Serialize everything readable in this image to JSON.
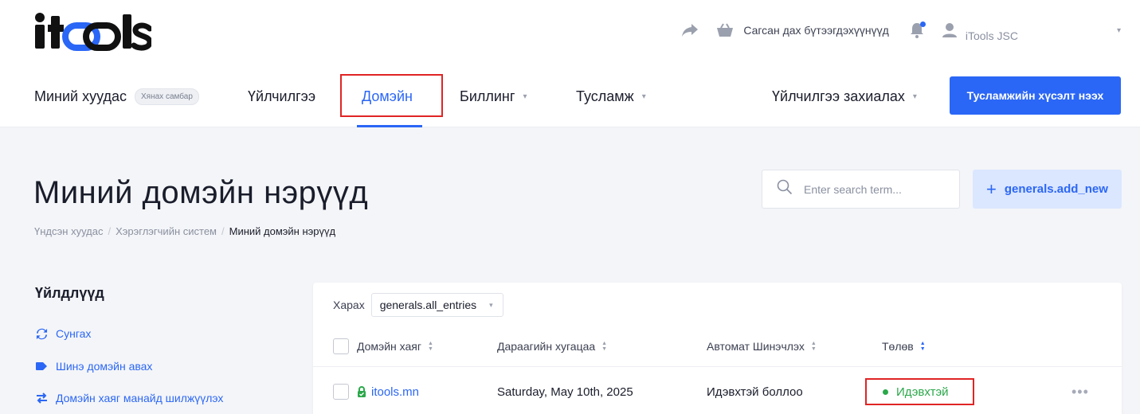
{
  "brand": {
    "logo_text": "itools",
    "accent": "#2b67f6",
    "status_green": "#2ba84a",
    "highlight_red": "#e02424"
  },
  "topbar": {
    "share_icon": "share-arrow-icon",
    "cart_icon": "basket-icon",
    "cart_label": "Сагсан дах бүтээгдэхүүнүүд",
    "bell_icon": "bell-icon",
    "user_icon": "user-icon",
    "user_label": "iTools JSC",
    "user_caret": "▾"
  },
  "nav": {
    "home_label": "Миний хуудас",
    "home_badge": "Хянах самбар",
    "services_label": "Үйлчилгээ",
    "domain_label": "Домэйн",
    "billing_label": "Биллинг",
    "help_label": "Тусламж",
    "order_label": "Үйлчилгээ захиалах",
    "caret": "▾",
    "support_button": "Тусламжийн хүсэлт нээх"
  },
  "page": {
    "title": "Миний домэйн нэрүүд",
    "breadcrumb": [
      "Үндсэн хуудас",
      "Хэрэглэгчийн систем",
      "Миний домэйн нэрүүд"
    ],
    "breadcrumb_sep": "/",
    "search_placeholder": "Enter search term...",
    "add_button": "generals.add_new",
    "add_plus": "+"
  },
  "sidebar": {
    "title": "Үйлдлүүд",
    "items": [
      {
        "label": "Сунгах",
        "icon": "refresh-icon"
      },
      {
        "label": "Шинэ домэйн авах",
        "icon": "tag-icon"
      },
      {
        "label": "Домэйн хаяг манайд шилжүүлэх",
        "icon": "transfer-icon"
      }
    ]
  },
  "table": {
    "filter_label": "Харах",
    "filter_value": "generals.all_entries",
    "filter_caret": "▾",
    "headers": [
      "Домэйн хаяг",
      "Дараагийн хугацаа",
      "Автомат Шинэчлэх",
      "Төлөв"
    ],
    "sort_up": "▲",
    "sort_down": "▼",
    "rows": [
      {
        "domain": "itools.mn",
        "next_due": "Saturday, May 10th, 2025",
        "auto_renew": "Идэвхтэй боллоо",
        "status": "Идэвхтэй",
        "more": "•••"
      }
    ]
  }
}
